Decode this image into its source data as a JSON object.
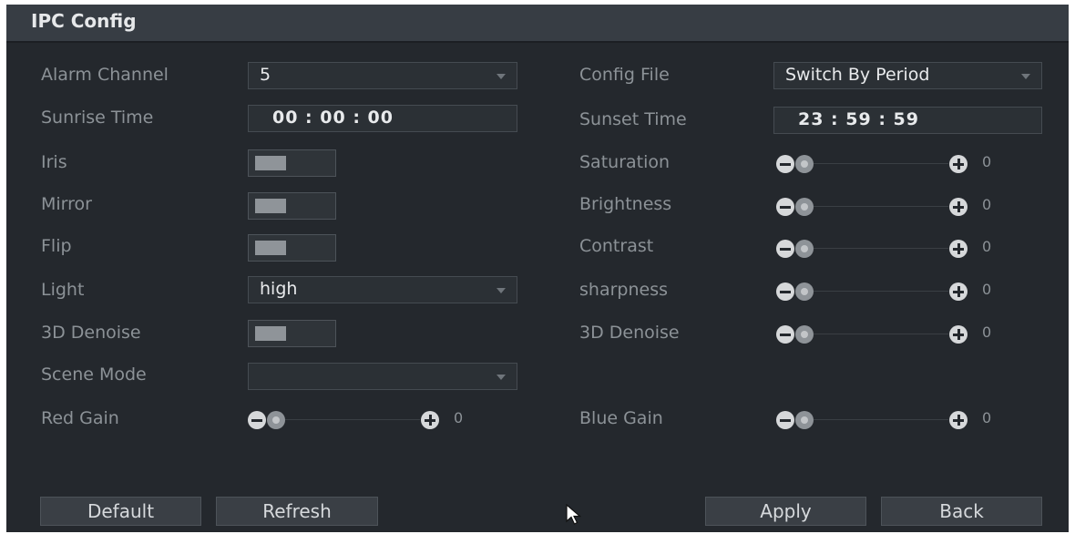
{
  "window": {
    "title": "IPC Config"
  },
  "left": {
    "alarm_channel": {
      "label": "Alarm Channel",
      "value": "5"
    },
    "sunrise_time": {
      "label": "Sunrise Time",
      "value": "00 :  00 :  00"
    },
    "iris": {
      "label": "Iris"
    },
    "mirror": {
      "label": "Mirror"
    },
    "flip": {
      "label": "Flip"
    },
    "light": {
      "label": "Light",
      "value": "high"
    },
    "denoise_3d": {
      "label": "3D Denoise"
    },
    "scene_mode": {
      "label": "Scene Mode",
      "value": ""
    },
    "red_gain": {
      "label": "Red Gain",
      "value": "0"
    }
  },
  "right": {
    "config_file": {
      "label": "Config File",
      "value": "Switch By Period"
    },
    "sunset_time": {
      "label": "Sunset Time",
      "value": "23 :  59 :  59"
    },
    "saturation": {
      "label": "Saturation",
      "value": "0"
    },
    "brightness": {
      "label": "Brightness",
      "value": "0"
    },
    "contrast": {
      "label": "Contrast",
      "value": "0"
    },
    "sharpness": {
      "label": "sharpness",
      "value": "0"
    },
    "denoise_3d": {
      "label": "3D Denoise",
      "value": "0"
    },
    "blue_gain": {
      "label": "Blue Gain",
      "value": "0"
    }
  },
  "buttons": {
    "default": "Default",
    "refresh": "Refresh",
    "apply": "Apply",
    "back": "Back"
  },
  "icons": {
    "slider_minus": "minus-circle-icon",
    "slider_plus": "plus-circle-icon",
    "dropdown": "caret-down-icon",
    "cursor": "mouse-pointer-icon"
  },
  "colors": {
    "background": "#24282d",
    "titlebar": "#373d44",
    "label": "#8c9297",
    "value": "#e8eaec"
  }
}
